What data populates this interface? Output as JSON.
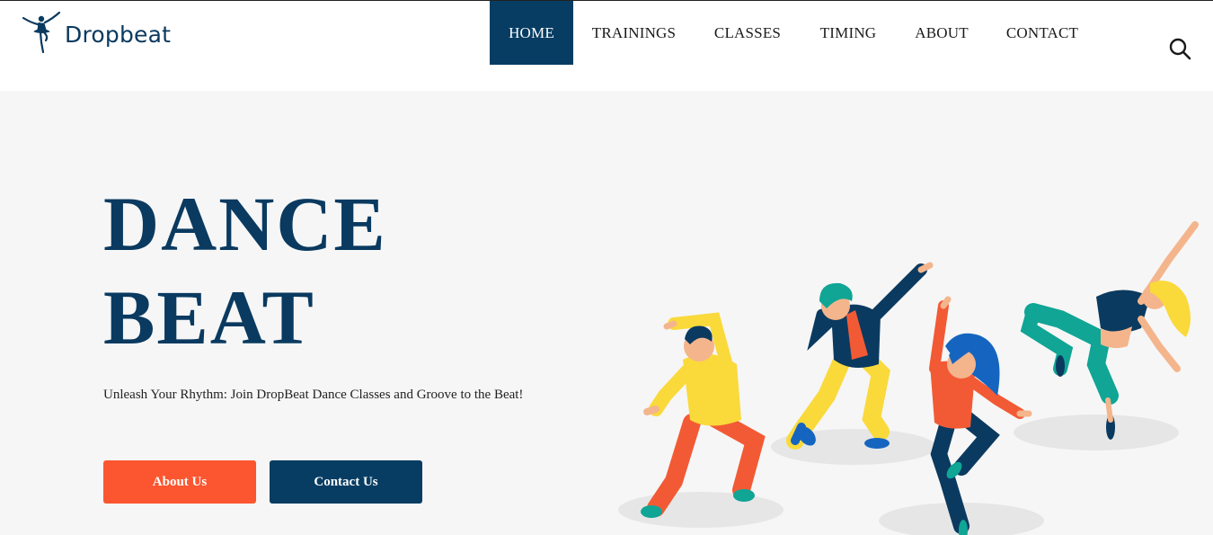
{
  "brand": {
    "name": "Dropbeat",
    "logo_icon": "ballerina-icon",
    "color": "#0b3a60"
  },
  "nav": {
    "items": [
      {
        "label": "HOME",
        "active": true
      },
      {
        "label": "TRAININGS",
        "active": false
      },
      {
        "label": "CLASSES",
        "active": false
      },
      {
        "label": "TIMING",
        "active": false
      },
      {
        "label": "ABOUT",
        "active": false
      },
      {
        "label": "CONTACT",
        "active": false
      }
    ],
    "search_icon": "search-icon",
    "active_color": "#073d63"
  },
  "hero": {
    "title_line1": "DANCE",
    "title_line2": "BEAT",
    "tagline": "Unleash Your Rhythm: Join DropBeat Dance Classes and Groove to the Beat!",
    "buttons": {
      "about": {
        "label": "About Us",
        "color": "#fb5630"
      },
      "contact": {
        "label": "Contact Us",
        "color": "#073d63"
      }
    },
    "illustration": "dancers-illustration"
  }
}
